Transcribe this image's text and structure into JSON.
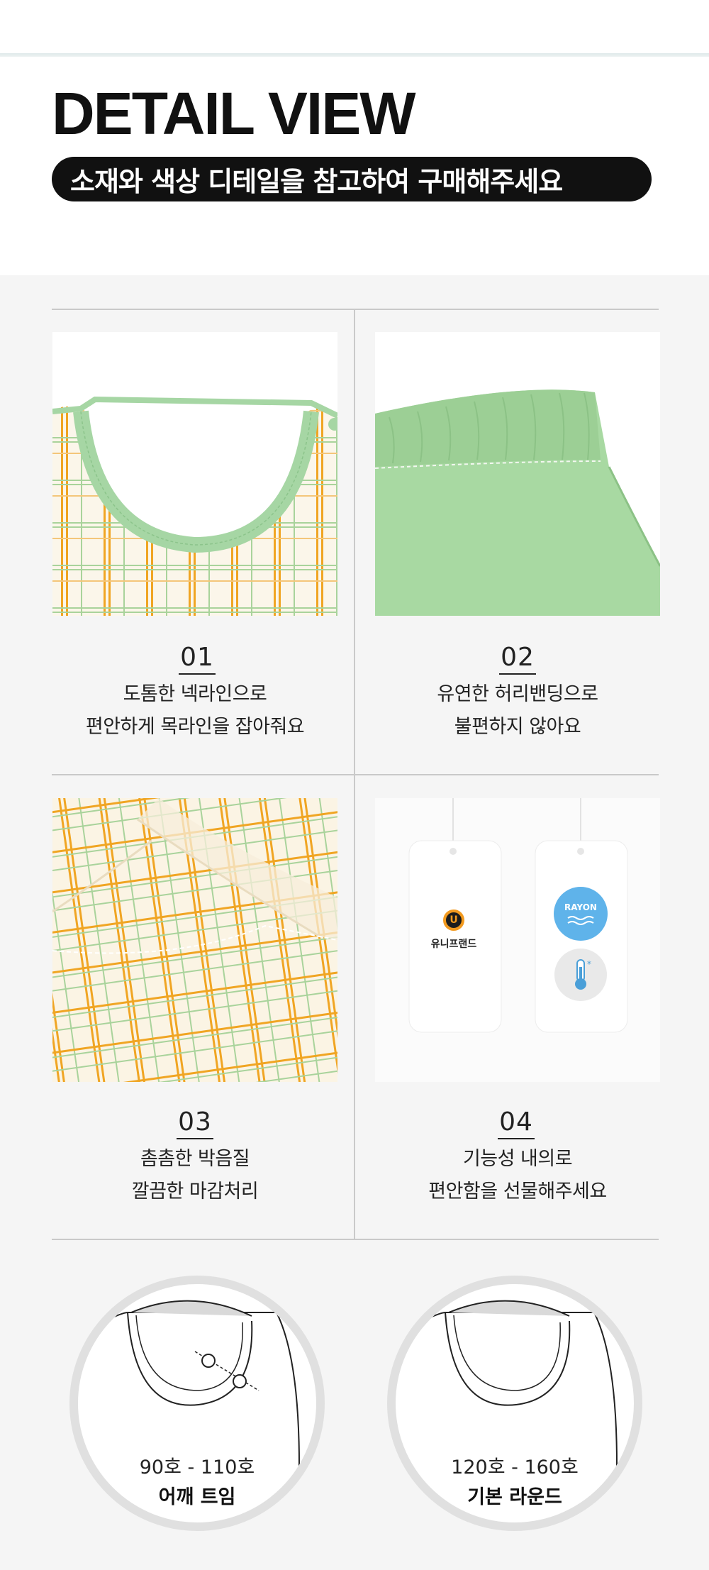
{
  "header": {
    "title": "DETAIL VIEW",
    "subtitle": "소재와 색상 디테일을 참고하여 구매해주세요"
  },
  "details": [
    {
      "number": "01",
      "line1": "도톰한 넥라인으로",
      "line2": "편안하게 목라인을 잡아줘요"
    },
    {
      "number": "02",
      "line1": "유연한 허리밴딩으로",
      "line2": "불편하지 않아요"
    },
    {
      "number": "03",
      "line1": "촘촘한 박음질",
      "line2": "깔끔한 마감처리"
    },
    {
      "number": "04",
      "line1": "기능성 내의로",
      "line2": "편안함을 선물해주세요"
    }
  ],
  "tags": {
    "brand_name": "유니프랜드",
    "brand_logo_letter": "U",
    "rayon_label": "RAYON"
  },
  "sizes": [
    {
      "range": "90호 - 110호",
      "type": "어깨 트임"
    },
    {
      "range": "120호 - 160호",
      "type": "기본 라운드"
    }
  ],
  "colors": {
    "mint": "#a6d6a4",
    "orange_check": "#f0a523",
    "green_check": "#a9d39b",
    "pants_green": "#a8d9a2",
    "rayon_blue": "#5fb3ea"
  }
}
